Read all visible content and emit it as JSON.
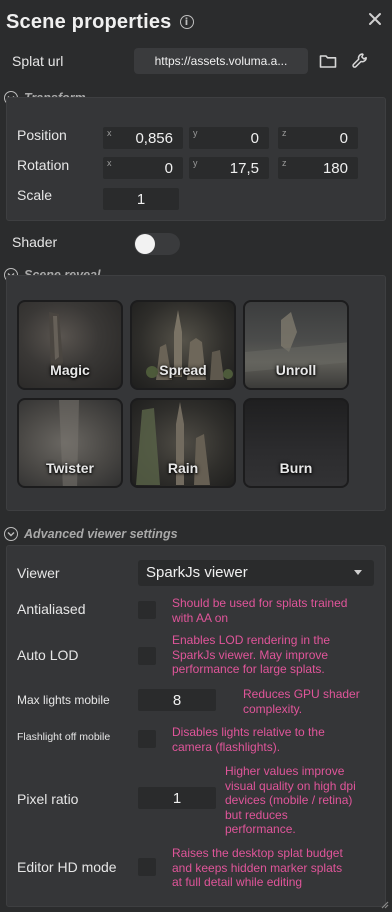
{
  "header": {
    "title": "Scene properties",
    "info_icon": "info-icon",
    "close_icon": "close-icon"
  },
  "splat_url": {
    "label": "Splat url",
    "value": "https://assets.voluma.a...",
    "folder_icon": "folder-icon",
    "wrench_icon": "wrench-icon"
  },
  "transform": {
    "title": "Transform",
    "position": {
      "label": "Position",
      "x": "0,856",
      "y": "0",
      "z": "0"
    },
    "rotation": {
      "label": "Rotation",
      "x": "0",
      "y": "17,5",
      "z": "180"
    },
    "scale": {
      "label": "Scale",
      "value": "1"
    },
    "axis_labels": {
      "x": "x",
      "y": "y",
      "z": "z"
    }
  },
  "shader": {
    "label": "Shader",
    "enabled": false
  },
  "scene_reveal": {
    "title": "Scene reveal",
    "cards": [
      "Magic",
      "Spread",
      "Unroll",
      "Twister",
      "Rain",
      "Burn"
    ]
  },
  "advanced": {
    "title": "Advanced viewer settings",
    "viewer": {
      "label": "Viewer",
      "value": "SparkJs viewer"
    },
    "antialiased": {
      "label": "Antialiased",
      "checked": false,
      "desc_lines": [
        "Should be used for splats trained",
        "with AA on"
      ]
    },
    "auto_lod": {
      "label": "Auto LOD",
      "checked": false,
      "desc_lines": [
        "Enables LOD rendering in the",
        "SparkJs viewer. May improve",
        "performance for large splats."
      ]
    },
    "max_lights_mobile": {
      "label": "Max lights mobile",
      "value": "8",
      "desc_lines": [
        "Reduces GPU shader",
        "complexity."
      ]
    },
    "flashlight_off_mobile": {
      "label": "Flashlight off mobile",
      "checked": false,
      "desc_lines": [
        "Disables lights relative to the",
        "camera (flashlights)."
      ]
    },
    "pixel_ratio": {
      "label": "Pixel ratio",
      "value": "1",
      "desc_lines": [
        "Higher values improve",
        "visual quality on high dpi",
        "devices (mobile / retina)",
        "but reduces",
        "performance."
      ]
    },
    "editor_hd_mode": {
      "label": "Editor HD mode",
      "checked": false,
      "desc_lines": [
        "Raises the desktop splat budget",
        "and keeps hidden marker splats",
        "at full detail while editing"
      ]
    }
  },
  "colors": {
    "accent_pink": "#e0559a",
    "panel_bg": "#2b2c2d",
    "section_bg": "#353638",
    "field_bg": "#2a2b2c"
  }
}
